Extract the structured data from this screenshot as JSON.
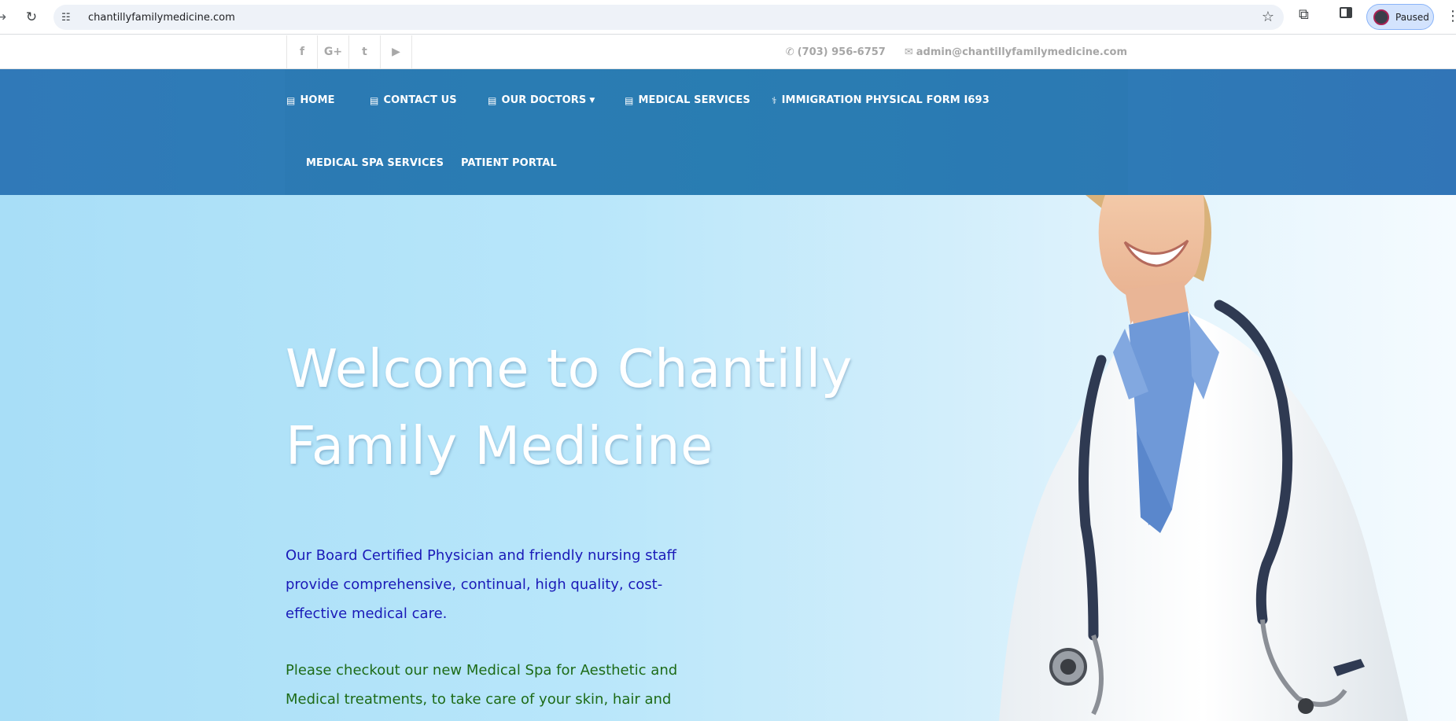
{
  "browser": {
    "url": "chantillyfamilymedicine.com",
    "profile_label": "Paused"
  },
  "topbar": {
    "social": [
      {
        "icon": "facebook-icon",
        "glyph": "f"
      },
      {
        "icon": "google-plus-icon",
        "glyph": "G+"
      },
      {
        "icon": "twitter-icon",
        "glyph": "t"
      },
      {
        "icon": "youtube-icon",
        "glyph": "▶"
      }
    ],
    "phone": "(703) 956-6757",
    "email": "admin@chantillyfamilymedicine.com"
  },
  "nav": {
    "items": [
      {
        "label": "HOME",
        "icon": "hospital-icon"
      },
      {
        "label": "CONTACT US",
        "icon": "hospital-icon"
      },
      {
        "label": "OUR DOCTORS",
        "icon": "hospital-icon"
      },
      {
        "label": "MEDICAL SERVICES",
        "icon": "hospital-icon"
      },
      {
        "label": "IMMIGRATION PHYSICAL FORM I693",
        "icon": "stethoscope-icon"
      },
      {
        "label": "MEDICAL SPA SERVICES"
      },
      {
        "label": "PATIENT PORTAL"
      }
    ]
  },
  "hero": {
    "title": "Welcome to Chantilly Family Medicine",
    "paragraph1": "Our Board Certified Physician and friendly nursing staff provide comprehensive, continual, high quality, cost-effective medical care.",
    "paragraph2": "Please checkout our new Medical Spa for Aesthetic and Medical treatments, to take care of your skin, hair and other medically"
  },
  "colors": {
    "nav_bg": "#2a80b4",
    "hero_bg": "#b8e6fa",
    "paragraph1": "#1a1ab8",
    "paragraph2": "#1d6b17"
  }
}
